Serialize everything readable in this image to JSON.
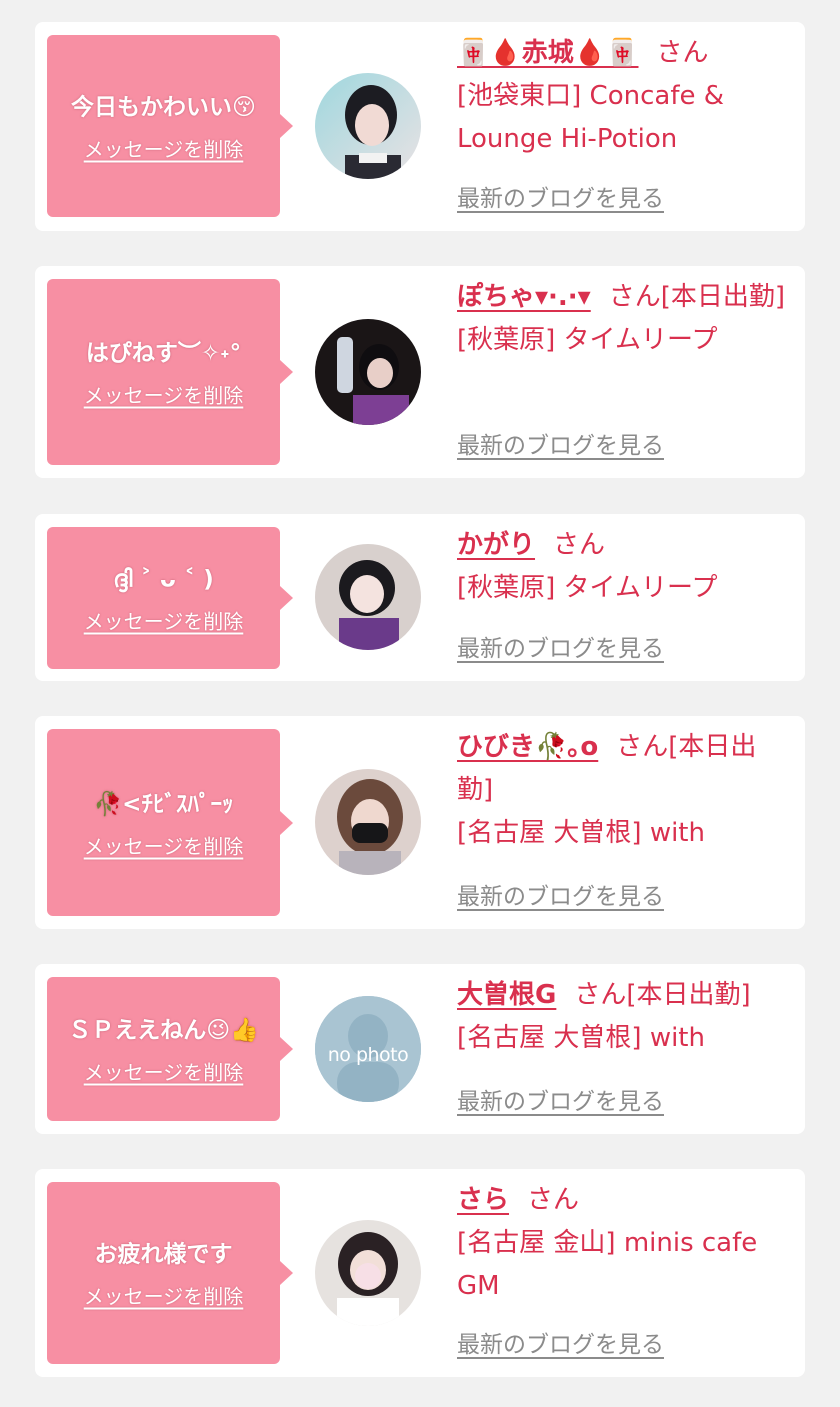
{
  "cards": [
    {
      "message": "今日もかわいい😚",
      "delete_label": "メッセージを削除",
      "name": "🀄🩸赤城🩸🀄",
      "suffix": "さん",
      "status": "",
      "shop": "[池袋東口] Concafe & Lounge Hi-Potion",
      "blog_link": "最新のブログを見る"
    },
    {
      "message": "はぴねす︶✧˖°",
      "delete_label": "メッセージを削除",
      "name": "ぽちゃ▾·.·▾",
      "suffix": "さん",
      "status": "[本日出勤]",
      "shop": "[秋葉原] タイムリープ",
      "blog_link": "最新のブログを見る"
    },
    {
      "message": "ദ്ദി ˃ ᴗ ˂ )",
      "delete_label": "メッセージを削除",
      "name": "かがり",
      "suffix": "さん",
      "status": "",
      "shop": "[秋葉原] タイムリープ",
      "blog_link": "最新のブログを見る"
    },
    {
      "message": "🥀<ﾁﾋﾞｽﾊﾟｰｯ",
      "delete_label": "メッセージを削除",
      "name": "ひびき🥀｡o",
      "suffix": "さん",
      "status": "[本日出勤]",
      "shop": "[名古屋 大曽根] with",
      "blog_link": "最新のブログを見る"
    },
    {
      "message": "ＳＰええねん😉👍",
      "delete_label": "メッセージを削除",
      "name": "大曽根G",
      "suffix": "さん",
      "status": "[本日出勤]",
      "shop": "[名古屋 大曽根] with",
      "blog_link": "最新のブログを見る",
      "avatar_text": "no photo"
    },
    {
      "message": "お疲れ様です",
      "delete_label": "メッセージを削除",
      "name": "さら",
      "suffix": "さん",
      "status": "",
      "shop": "[名古屋 金山] minis cafe GM",
      "blog_link": "最新のブログを見る"
    }
  ],
  "colors": {
    "background": "#f1f1f1",
    "bubble": "#f78fa3",
    "accent": "#d9304e",
    "link_gray": "#8b8b8b"
  }
}
